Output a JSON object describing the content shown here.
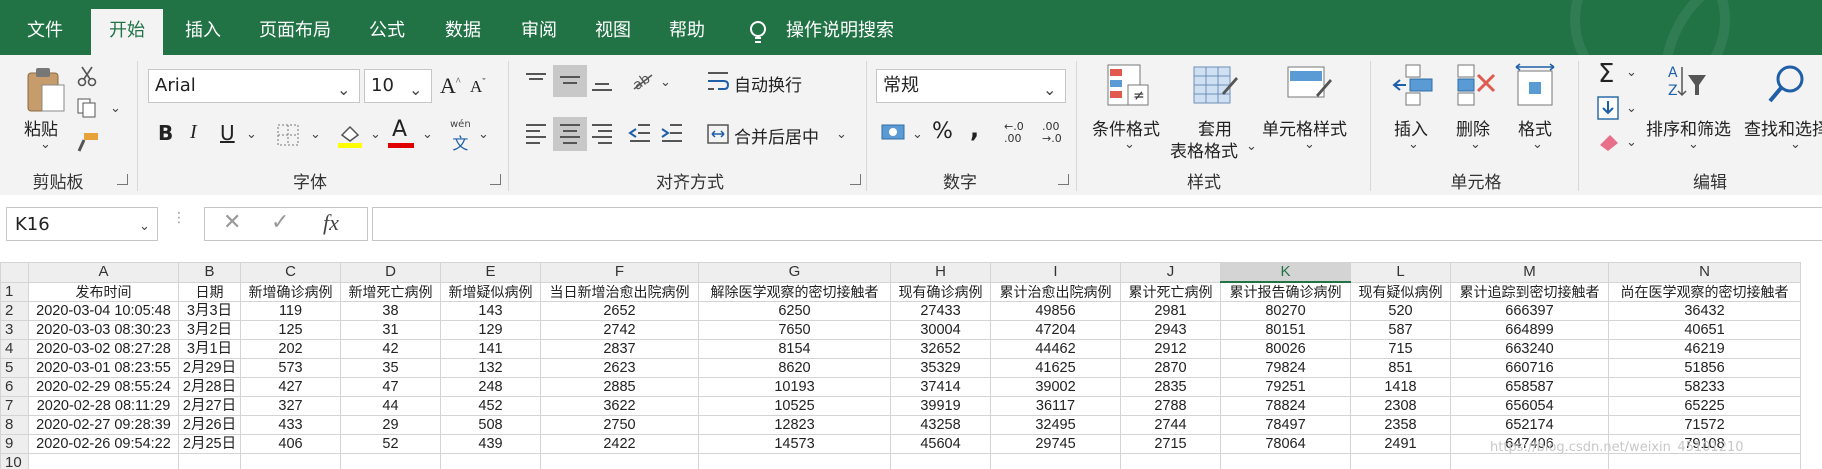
{
  "tabs": [
    {
      "label": "文件",
      "active": false
    },
    {
      "label": "开始",
      "active": true
    },
    {
      "label": "插入",
      "active": false
    },
    {
      "label": "页面布局",
      "active": false
    },
    {
      "label": "公式",
      "active": false
    },
    {
      "label": "数据",
      "active": false
    },
    {
      "label": "审阅",
      "active": false
    },
    {
      "label": "视图",
      "active": false
    },
    {
      "label": "帮助",
      "active": false
    }
  ],
  "search_label": "操作说明搜索",
  "ribbon": {
    "clipboard": {
      "paste": "粘贴",
      "group": "剪贴板"
    },
    "font": {
      "name": "Arial",
      "size": "10",
      "group": "字体",
      "wen": "wén",
      "wen_char": "文"
    },
    "alignment": {
      "wrap": "自动换行",
      "merge": "合并后居中",
      "group": "对齐方式"
    },
    "number": {
      "format": "常规",
      "group": "数字",
      "percent": "%",
      "comma": ","
    },
    "styles": {
      "conditional": "条件格式",
      "table_line1": "套用",
      "table_line2": "表格格式",
      "cell_styles": "单元格样式",
      "group": "样式"
    },
    "cells": {
      "insert": "插入",
      "delete": "删除",
      "format": "格式",
      "group": "单元格"
    },
    "editing": {
      "sort": "排序和筛选",
      "find": "查找和选择",
      "group": "编辑"
    }
  },
  "namebox": "K16",
  "fx": "fx",
  "columns": [
    "A",
    "B",
    "C",
    "D",
    "E",
    "F",
    "G",
    "H",
    "I",
    "J",
    "K",
    "L",
    "M",
    "N"
  ],
  "selected_column": "K",
  "rows": [
    [
      "发布时间",
      "日期",
      "新增确诊病例",
      "新增死亡病例",
      "新增疑似病例",
      "当日新增治愈出院病例",
      "解除医学观察的密切接触者",
      "现有确诊病例",
      "累计治愈出院病例",
      "累计死亡病例",
      "累计报告确诊病例",
      "现有疑似病例",
      "累计追踪到密切接触者",
      "尚在医学观察的密切接触者"
    ],
    [
      "2020-03-04 10:05:48",
      "3月3日",
      "119",
      "38",
      "143",
      "2652",
      "6250",
      "27433",
      "49856",
      "2981",
      "80270",
      "520",
      "666397",
      "36432"
    ],
    [
      "2020-03-03 08:30:23",
      "3月2日",
      "125",
      "31",
      "129",
      "2742",
      "7650",
      "30004",
      "47204",
      "2943",
      "80151",
      "587",
      "664899",
      "40651"
    ],
    [
      "2020-03-02 08:27:28",
      "3月1日",
      "202",
      "42",
      "141",
      "2837",
      "8154",
      "32652",
      "44462",
      "2912",
      "80026",
      "715",
      "663240",
      "46219"
    ],
    [
      "2020-03-01 08:23:55",
      "2月29日",
      "573",
      "35",
      "132",
      "2623",
      "8620",
      "35329",
      "41625",
      "2870",
      "79824",
      "851",
      "660716",
      "51856"
    ],
    [
      "2020-02-29 08:55:24",
      "2月28日",
      "427",
      "47",
      "248",
      "2885",
      "10193",
      "37414",
      "39002",
      "2835",
      "79251",
      "1418",
      "658587",
      "58233"
    ],
    [
      "2020-02-28 08:11:29",
      "2月27日",
      "327",
      "44",
      "452",
      "3622",
      "10525",
      "39919",
      "36117",
      "2788",
      "78824",
      "2308",
      "656054",
      "65225"
    ],
    [
      "2020-02-27 09:28:39",
      "2月26日",
      "433",
      "29",
      "508",
      "2750",
      "12823",
      "43258",
      "32495",
      "2744",
      "78497",
      "2358",
      "652174",
      "71572"
    ],
    [
      "2020-02-26 09:54:22",
      "2月25日",
      "406",
      "52",
      "439",
      "2422",
      "14573",
      "45604",
      "29745",
      "2715",
      "78064",
      "2491",
      "647406",
      "79108"
    ],
    [
      "",
      "",
      "",
      "",
      "",
      "",
      "",
      "",
      "",
      "",
      "",
      "",
      "",
      ""
    ]
  ],
  "row_numbers": [
    "1",
    "2",
    "3",
    "4",
    "5",
    "6",
    "7",
    "8",
    "9",
    "10"
  ],
  "watermark": "https://blog.csdn.net/weixin_45101210",
  "colors": {
    "accent": "#217346",
    "ribbon_bg": "#f3f3f3",
    "grid_line": "#d4d4d4"
  }
}
